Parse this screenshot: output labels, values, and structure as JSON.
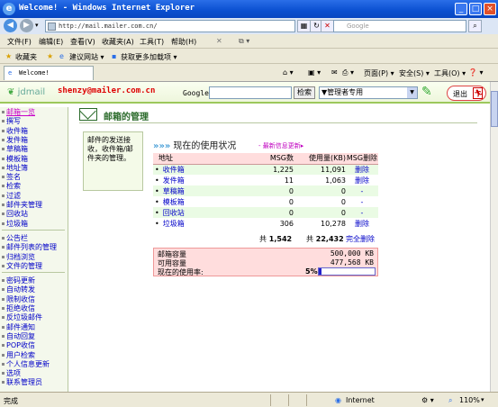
{
  "window": {
    "title": "Welcome! - Windows Internet Explorer",
    "minimize": "_",
    "maximize": "□",
    "close": "×"
  },
  "address": {
    "url": "http://mail.mailer.com.cn/",
    "search_placeholder": "Google"
  },
  "menu": [
    "文件(F)",
    "编辑(E)",
    "查看(V)",
    "收藏夹(A)",
    "工具(T)",
    "帮助(H)"
  ],
  "favbar": {
    "favorites": "收藏夹",
    "suggested_sites": "建议网站 ▾",
    "get_addons": "获取更多加载项 ▾"
  },
  "tab": {
    "title": "Welcome!"
  },
  "toolbar": {
    "page": "页面(P) ▾",
    "safety": "安全(S) ▾",
    "tools": "工具(O) ▾",
    "help": "❓ ▾"
  },
  "mailheader": {
    "logo": "jdmail",
    "email": "shenzy@mailer.com.cn",
    "google_label": "Google",
    "search_button": "检索",
    "select_value": "▼管理者专用",
    "logout": "退出"
  },
  "sidebar": {
    "group1": [
      "邮箱一览",
      "撰写",
      "收件箱",
      "发件箱",
      "草稿箱",
      "模板箱",
      "地址簿",
      "签名",
      "检索",
      "过滤",
      "邮件夹管理",
      "回收站",
      "垃圾箱"
    ],
    "group2": [
      "公告栏",
      "邮件列表的管理",
      "归档浏览",
      "文件的管理"
    ],
    "group3": [
      "密码更新",
      "自动转发",
      "限制收信",
      "拒绝收信",
      "反垃圾邮件",
      "邮件通知",
      "自动回复",
      "POP收信",
      "用户检索",
      "个人信息更新",
      "选项",
      "联系管理员"
    ]
  },
  "main": {
    "title": "邮箱的管理",
    "description": "邮件的发送接收，收件箱/邮件夹的管理。",
    "usage_title": "现在的使用状况",
    "usage_arrows": "»»»",
    "latest_link": "- 最新信息更新▸",
    "table": {
      "headers": [
        "地址",
        "MSG数",
        "使用量(KB)",
        "MSG删除"
      ],
      "rows": [
        {
          "name": "收件箱",
          "msgs": "1,225",
          "kb": "11,091",
          "del": "删除"
        },
        {
          "name": "发件箱",
          "msgs": "11",
          "kb": "1,063",
          "del": "删除"
        },
        {
          "name": "草稿箱",
          "msgs": "0",
          "kb": "0",
          "del": "-"
        },
        {
          "name": "模板箱",
          "msgs": "0",
          "kb": "0",
          "del": "-"
        },
        {
          "name": "回收站",
          "msgs": "0",
          "kb": "0",
          "del": "-"
        },
        {
          "name": "垃圾箱",
          "msgs": "306",
          "kb": "10,278",
          "del": "删除"
        }
      ]
    },
    "totals": {
      "label1": "共",
      "total_msgs": "1,542",
      "label2": "共",
      "total_kb": "22,432",
      "delete_all": "完全删除"
    },
    "capacity": {
      "mail_capacity_label": "邮箱容量",
      "mail_capacity_value": "500,000 KB",
      "available_label": "可用容量",
      "available_value": "477,568 KB",
      "usage_rate_label": "现在的使用率:",
      "usage_percent": "5%",
      "usage_fraction": 0.05
    }
  },
  "status": {
    "left": "完成",
    "zone": "Internet",
    "zoom": "110%"
  }
}
